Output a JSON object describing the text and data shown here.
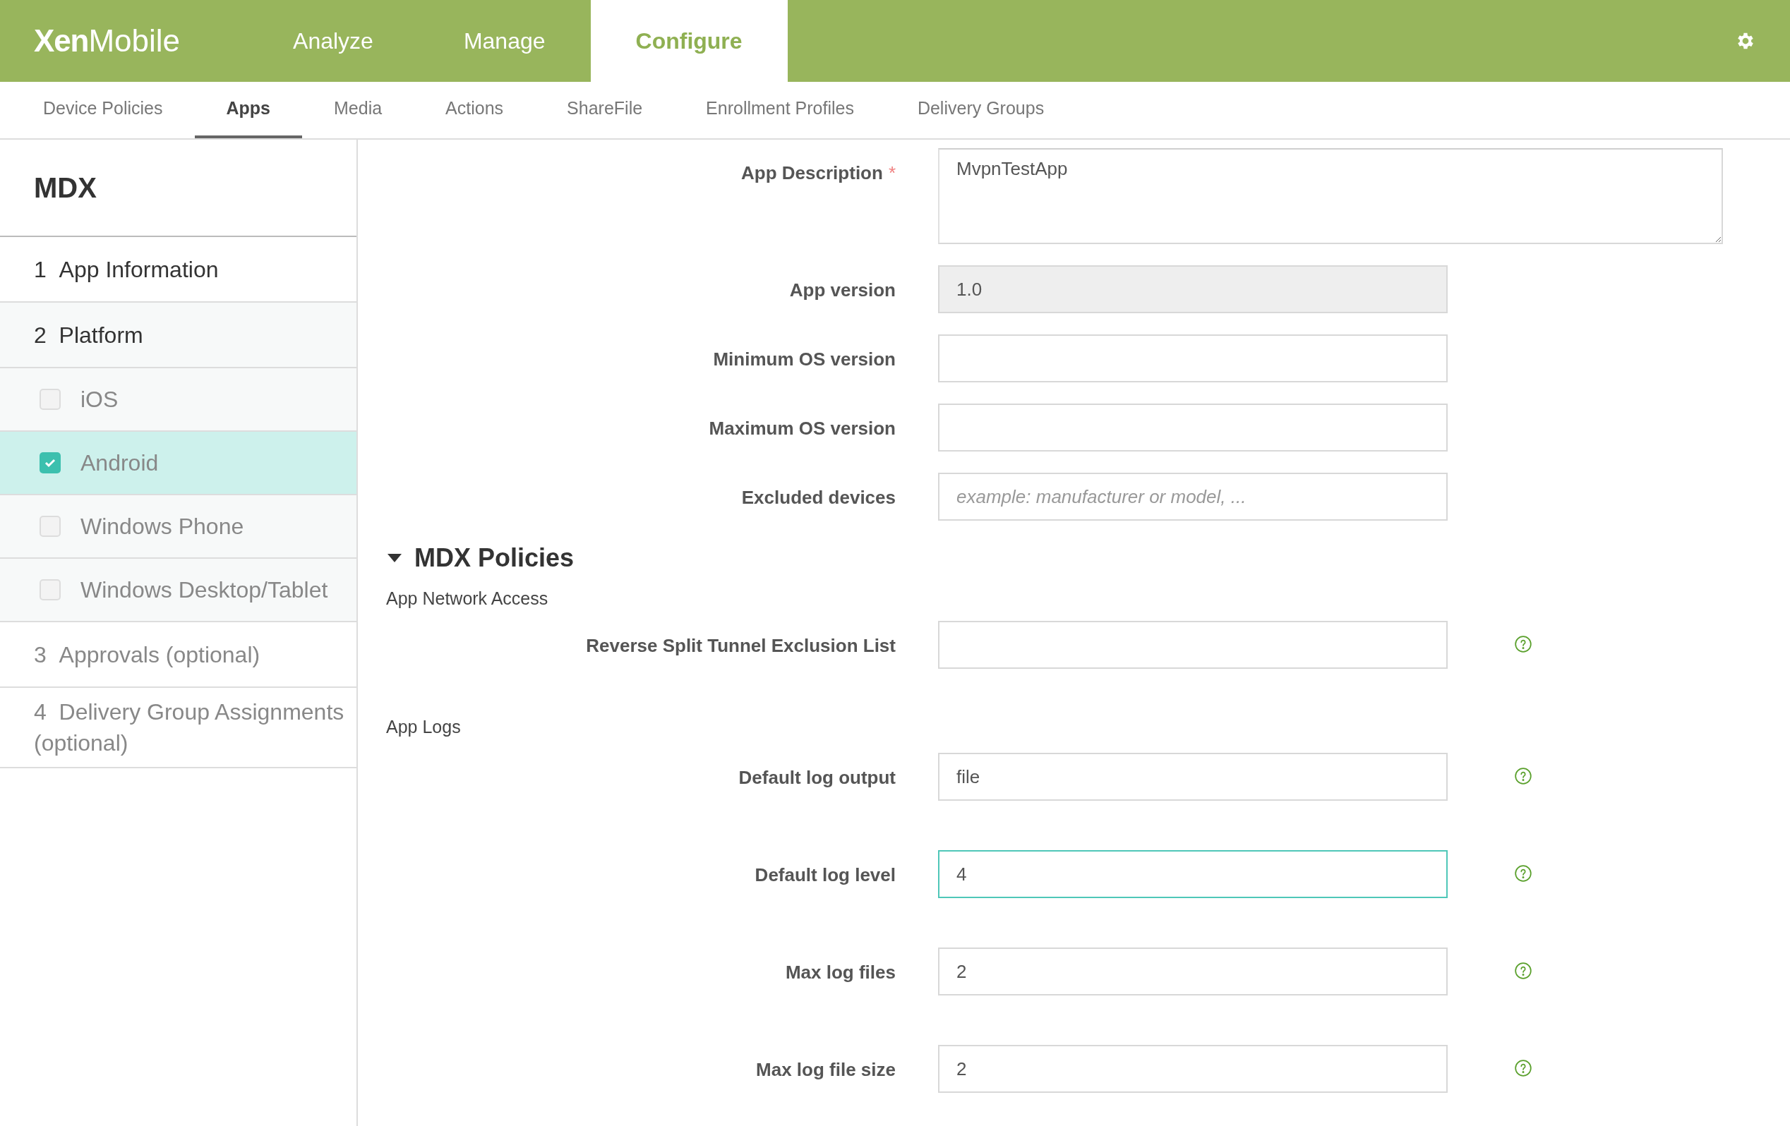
{
  "header": {
    "logo_bold": "Xen",
    "logo_light": "Mobile",
    "tabs": [
      {
        "label": "Analyze",
        "selected": false
      },
      {
        "label": "Manage",
        "selected": false
      },
      {
        "label": "Configure",
        "selected": true
      }
    ]
  },
  "subnav": [
    {
      "label": "Device Policies",
      "selected": false
    },
    {
      "label": "Apps",
      "selected": true
    },
    {
      "label": "Media",
      "selected": false
    },
    {
      "label": "Actions",
      "selected": false
    },
    {
      "label": "ShareFile",
      "selected": false
    },
    {
      "label": "Enrollment Profiles",
      "selected": false
    },
    {
      "label": "Delivery Groups",
      "selected": false
    }
  ],
  "sidebar": {
    "title": "MDX",
    "steps": [
      {
        "number": "1",
        "label": "App Information",
        "enabled": true
      },
      {
        "number": "2",
        "label": "Platform",
        "enabled": true,
        "children": [
          {
            "label": "iOS",
            "checked": false,
            "selected": false
          },
          {
            "label": "Android",
            "checked": true,
            "selected": true
          },
          {
            "label": "Windows Phone",
            "checked": false,
            "selected": false
          },
          {
            "label": "Windows Desktop/Tablet",
            "checked": false,
            "selected": false
          }
        ]
      },
      {
        "number": "3",
        "label": "Approvals (optional)",
        "enabled": false
      },
      {
        "number": "4",
        "label": "Delivery Group Assignments (optional)",
        "enabled": false
      }
    ]
  },
  "form": [
    {
      "kind": "textarea",
      "label": "App Description",
      "required_mark": "*",
      "value": "MvpnTestApp"
    },
    {
      "kind": "input",
      "label": "App version",
      "value": "1.0",
      "disabled": true,
      "focused": false,
      "help": false
    },
    {
      "kind": "input",
      "label": "Minimum OS version",
      "disabled": false,
      "focused": false,
      "help": false
    },
    {
      "kind": "input",
      "label": "Maximum OS version",
      "disabled": false,
      "focused": false,
      "help": false
    },
    {
      "kind": "input",
      "label": "Excluded devices",
      "placeholder": "example: manufacturer or model, ...",
      "disabled": false,
      "focused": false,
      "help": false
    },
    {
      "kind": "section",
      "label": "MDX Policies",
      "expanded": true
    },
    {
      "kind": "group",
      "label": "App Network Access"
    },
    {
      "kind": "input",
      "label": "Reverse Split Tunnel Exclusion List",
      "disabled": false,
      "focused": false,
      "help": true
    },
    {
      "kind": "group",
      "label": "App Logs"
    },
    {
      "kind": "input",
      "label": "Default log output",
      "value": "file",
      "disabled": false,
      "focused": false,
      "help": true
    },
    {
      "kind": "input",
      "label": "Default log level",
      "value": "4",
      "disabled": false,
      "focused": true,
      "help": true
    },
    {
      "kind": "input",
      "label": "Max log files",
      "value": "2",
      "disabled": false,
      "focused": false,
      "help": true
    },
    {
      "kind": "input",
      "label": "Max log file size",
      "value": "2",
      "disabled": false,
      "focused": false,
      "help": true
    }
  ]
}
